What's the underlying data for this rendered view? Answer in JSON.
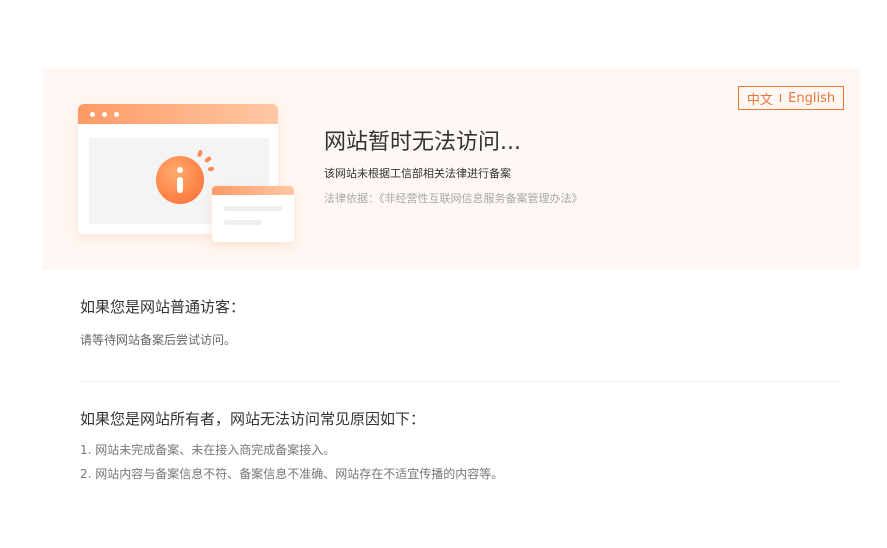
{
  "language_switch": {
    "chinese": "中文",
    "separator": "I",
    "english": "English",
    "accent_color": "#e8773a"
  },
  "illustration": {
    "icon": "info-icon",
    "badge_color": "#fb6a2f"
  },
  "banner": {
    "title": "网站暂时无法访问...",
    "subtitle": "该网站未根据工信部相关法律进行备案",
    "legal_basis": "法律依据：《非经营性互联网信息服务备案管理办法》",
    "background_color": "#fff7f3"
  },
  "visitor": {
    "heading": "如果您是网站普通访客：",
    "text": "请等待网站备案后尝试访问。"
  },
  "owner": {
    "heading": "如果您是网站所有者，网站无法访问常见原因如下：",
    "reasons": [
      "1. 网站未完成备案、未在接入商完成备案接入。",
      "2. 网站内容与备案信息不符、备案信息不准确、网站存在不适宜传播的内容等。"
    ]
  }
}
